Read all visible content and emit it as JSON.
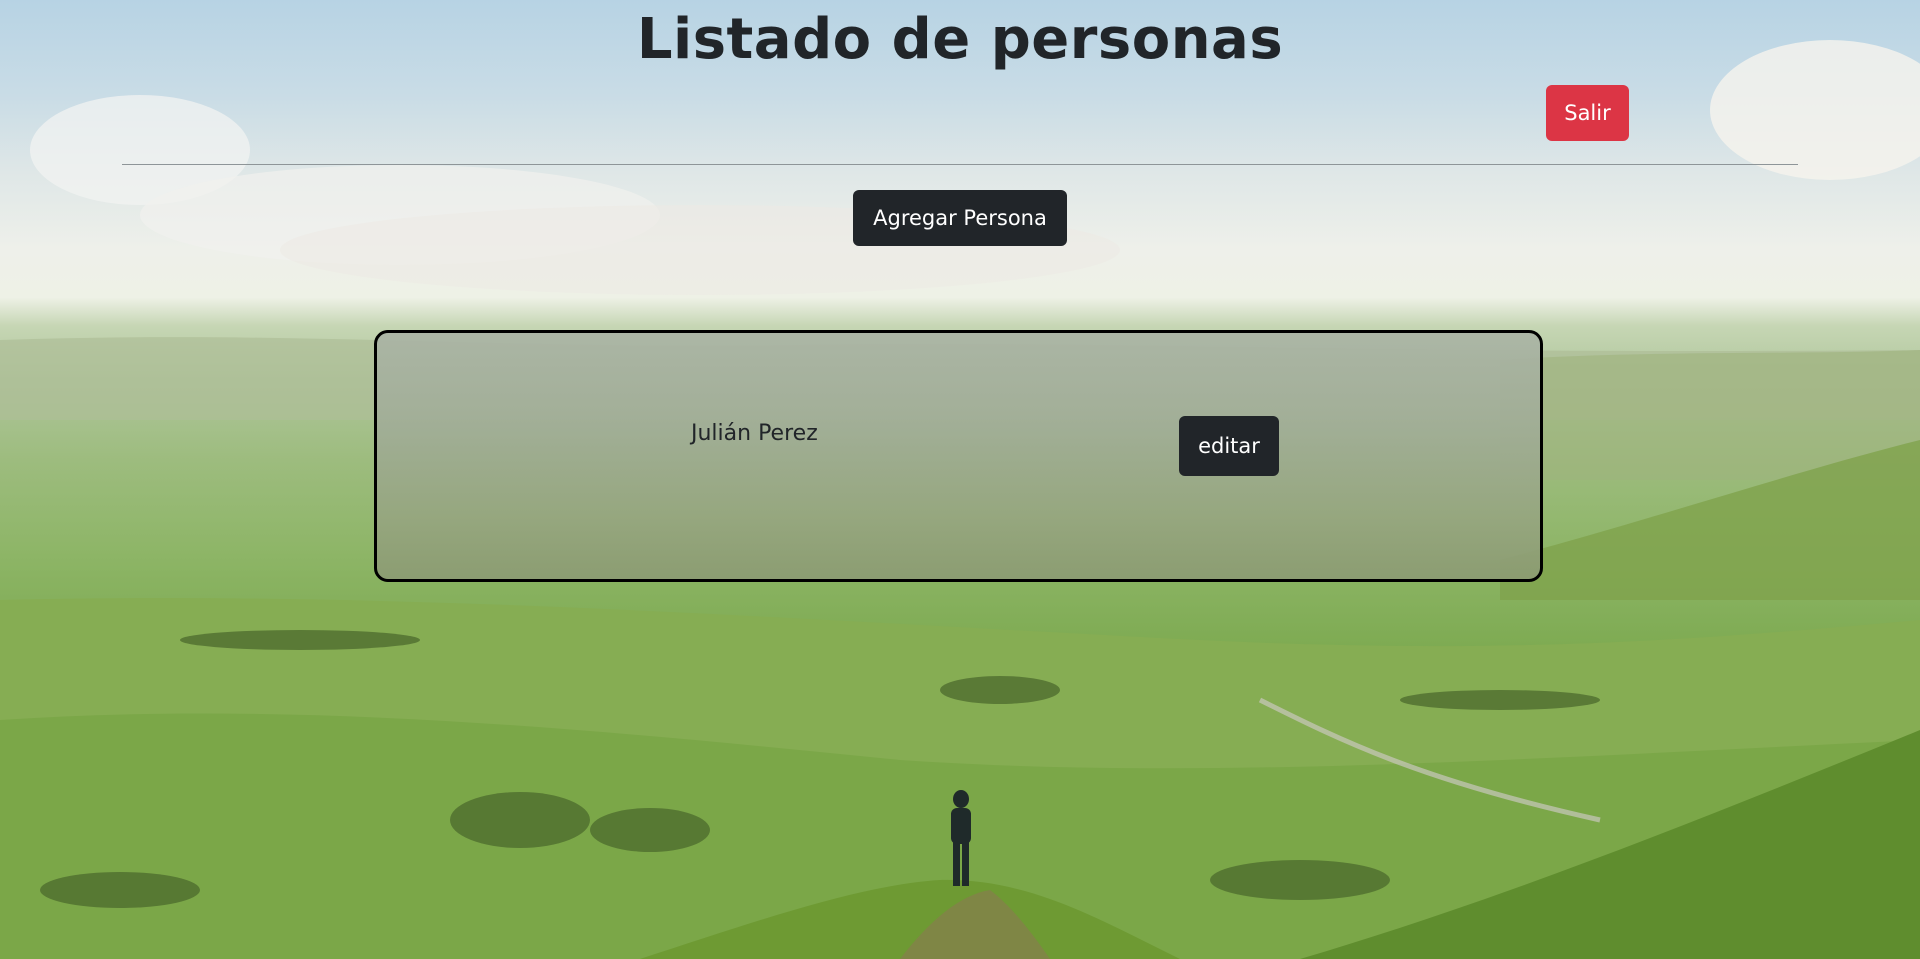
{
  "header": {
    "title": "Listado de personas",
    "logout_label": "Salir",
    "add_person_label": "Agregar Persona"
  },
  "people": [
    {
      "name": "Julián Perez",
      "edit_label": "editar"
    }
  ],
  "colors": {
    "title_text": "#212529",
    "danger": "#dc3545",
    "dark_button": "#212529",
    "card_border": "#000000"
  },
  "background": {
    "description_icon": "landscape-photo"
  }
}
